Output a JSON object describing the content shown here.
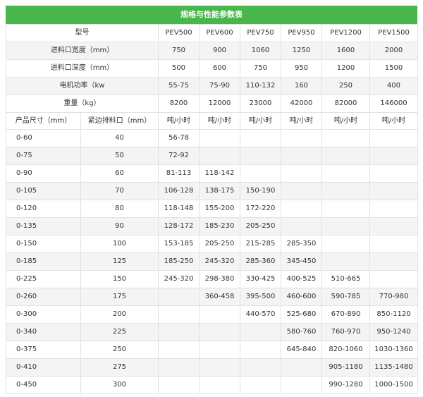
{
  "title": "规格与性能参数表",
  "models": [
    "PEV500",
    "PEV600",
    "PEV750",
    "PEV950",
    "PEV1200",
    "PEV1500"
  ],
  "spec_rows": [
    {
      "label": "型号",
      "values": [
        "PEV500",
        "PEV600",
        "PEV750",
        "PEV950",
        "PEV1200",
        "PEV1500"
      ]
    },
    {
      "label": "进料口宽度（mm）",
      "values": [
        "750",
        "900",
        "1060",
        "1250",
        "1600",
        "2000"
      ]
    },
    {
      "label": "进料口深度（mm）",
      "values": [
        "500",
        "600",
        "750",
        "950",
        "1200",
        "1500"
      ]
    },
    {
      "label": "电机功率（kw",
      "values": [
        "55-75",
        "75-90",
        "110-132",
        "160",
        "250",
        "400"
      ]
    },
    {
      "label": "重量（kg）",
      "values": [
        "8200",
        "12000",
        "23000",
        "42000",
        "82000",
        "146000"
      ]
    }
  ],
  "unit_row": {
    "col1": "产品尺寸（mm）",
    "col2": "紧边排料口（mm）",
    "units": [
      "吨/小时",
      "吨/小时",
      "吨/小时",
      "吨/小时",
      "吨/小时",
      "吨/小时"
    ]
  },
  "data_rows": [
    {
      "size": "0-60",
      "css": "40",
      "values": [
        "56-78",
        "",
        "",
        "",
        "",
        ""
      ]
    },
    {
      "size": "0-75",
      "css": "50",
      "values": [
        "72-92",
        "",
        "",
        "",
        "",
        ""
      ]
    },
    {
      "size": "0-90",
      "css": "60",
      "values": [
        "81-113",
        "118-142",
        "",
        "",
        "",
        ""
      ]
    },
    {
      "size": "0-105",
      "css": "70",
      "values": [
        "106-128",
        "138-175",
        "150-190",
        "",
        "",
        ""
      ]
    },
    {
      "size": "0-120",
      "css": "80",
      "values": [
        "118-148",
        "155-200",
        "172-220",
        "",
        "",
        ""
      ]
    },
    {
      "size": "0-135",
      "css": "90",
      "values": [
        "128-172",
        "185-230",
        "205-250",
        "",
        "",
        ""
      ]
    },
    {
      "size": "0-150",
      "css": "100",
      "values": [
        "153-185",
        "205-250",
        "215-285",
        "285-350",
        "",
        ""
      ]
    },
    {
      "size": "0-185",
      "css": "125",
      "values": [
        "185-250",
        "245-320",
        "285-360",
        "345-450",
        "",
        ""
      ]
    },
    {
      "size": "0-225",
      "css": "150",
      "values": [
        "245-320",
        "298-380",
        "330-425",
        "400-525",
        "510-665",
        ""
      ]
    },
    {
      "size": "0-260",
      "css": "175",
      "values": [
        "",
        "360-458",
        "395-500",
        "460-600",
        "590-785",
        "770-980"
      ]
    },
    {
      "size": "0-300",
      "css": "200",
      "values": [
        "",
        "",
        "440-570",
        "525-680",
        "670-890",
        "850-1120"
      ]
    },
    {
      "size": "0-340",
      "css": "225",
      "values": [
        "",
        "",
        "",
        "580-760",
        "760-970",
        "950-1240"
      ]
    },
    {
      "size": "0-375",
      "css": "250",
      "values": [
        "",
        "",
        "",
        "645-840",
        "820-1060",
        "1030-1360"
      ]
    },
    {
      "size": "0-410",
      "css": "275",
      "values": [
        "",
        "",
        "",
        "",
        "905-1180",
        "1135-1480"
      ]
    },
    {
      "size": "0-450",
      "css": "300",
      "values": [
        "",
        "",
        "",
        "",
        "990-1280",
        "1000-1500"
      ]
    }
  ]
}
